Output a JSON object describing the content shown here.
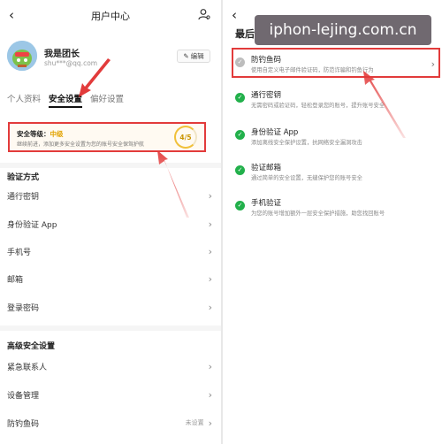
{
  "left": {
    "header": {
      "back": "‹",
      "title": "用户中心"
    },
    "profile": {
      "name": "我是团长",
      "email": "shu***@qq.com",
      "edit_label": "编辑"
    },
    "tabs": [
      "个人资料",
      "安全设置",
      "偏好设置"
    ],
    "security": {
      "level_label": "安全等级：",
      "level_value": "中级",
      "desc": "继续前进，添加更多安全设置为您的账号安全保驾护航",
      "score": "4/5"
    },
    "auth_section": {
      "title": "验证方式",
      "items": [
        {
          "label": "通行密钥"
        },
        {
          "label": "身份验证 App"
        },
        {
          "label": "手机号"
        },
        {
          "label": "邮箱"
        },
        {
          "label": "登录密码"
        }
      ]
    },
    "advanced_section": {
      "title": "高级安全设置",
      "items": [
        {
          "label": "紧急联系人",
          "status": ""
        },
        {
          "label": "设备管理",
          "status": ""
        },
        {
          "label": "防钓鱼码",
          "status": "未设置"
        }
      ]
    }
  },
  "right": {
    "header": {
      "back": "‹",
      "title": "最后"
    },
    "watermark": "iphon-lejing.com.cn",
    "items": [
      {
        "title": "防钓鱼码",
        "desc": "使用自定义电子邮件验证码，防范诈骗和钓鱼行为",
        "done": false
      },
      {
        "title": "通行密钥",
        "desc": "无需密码或验证码，轻松登录您的账号，提升账号安全",
        "done": true
      },
      {
        "title": "身份验证 App",
        "desc": "添加离线安全保护设置，抗网络安全漏洞攻击",
        "done": true
      },
      {
        "title": "验证邮箱",
        "desc": "通过简单的安全设置，无缝保护您的账号安全",
        "done": true
      },
      {
        "title": "手机验证",
        "desc": "为您的账号增加额外一层安全保护措施，助您找回账号",
        "done": true
      }
    ]
  },
  "colors": {
    "highlight": "#e23b3b",
    "success": "#22b04b",
    "level": "#e2a300"
  },
  "icons": [
    "user-settings-icon",
    "avatar-image",
    "edit-icon",
    "chevron-right-icon",
    "check-circle-icon"
  ]
}
